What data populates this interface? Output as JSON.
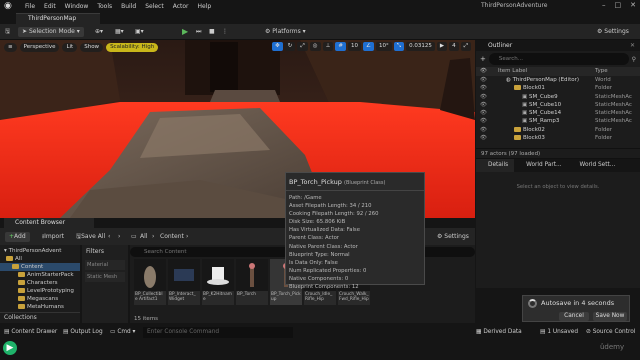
{
  "app": {
    "window_title": "ThirdPersonAdventure",
    "menu": [
      "File",
      "Edit",
      "Window",
      "Tools",
      "Build",
      "Select",
      "Actor",
      "Help"
    ],
    "level_tab": "ThirdPersonMap"
  },
  "toolbar": {
    "selection_mode": "Selection Mode",
    "platforms": "Platforms",
    "settings": "Settings"
  },
  "viewport": {
    "perspective": "Perspective",
    "lit": "Lit",
    "show": "Show",
    "scalability": "Scalability: High",
    "grid_snap": "10",
    "rot_snap": "10°",
    "scale_snap": "0.03125",
    "cam_speed": "4"
  },
  "tooltip": {
    "name": "BP_Torch_Pickup",
    "class": "(Blueprint Class)",
    "rows": [
      "Path: /Game",
      "Asset Filepath Length: 34 / 210",
      "Cooking Filepath Length: 92 / 260",
      "Disk Size: 65.806 KiB",
      "Has Virtualized Data: False",
      "Parent Class: Actor",
      "Native Parent Class: Actor",
      "Blueprint Type: Normal",
      "Is Data Only: False",
      "Num Replicated Properties: 0",
      "Native Components: 0",
      "Blueprint Components: 12"
    ]
  },
  "outliner": {
    "title": "Outliner",
    "search_placeholder": "Search...",
    "col_label": "Item Label",
    "col_type": "Type",
    "rows": [
      {
        "label": "ThirdPersonMap (Editor)",
        "type": "World",
        "indent": 0,
        "kind": "world"
      },
      {
        "label": "Block01",
        "type": "Folder",
        "indent": 1,
        "kind": "folder"
      },
      {
        "label": "SM_Cube9",
        "type": "StaticMeshAc",
        "indent": 2,
        "kind": "mesh"
      },
      {
        "label": "SM_Cube10",
        "type": "StaticMeshAc",
        "indent": 2,
        "kind": "mesh"
      },
      {
        "label": "SM_Cube14",
        "type": "StaticMeshAc",
        "indent": 2,
        "kind": "mesh"
      },
      {
        "label": "SM_Ramp3",
        "type": "StaticMeshAc",
        "indent": 2,
        "kind": "mesh"
      },
      {
        "label": "Block02",
        "type": "Folder",
        "indent": 1,
        "kind": "folder"
      },
      {
        "label": "Block03",
        "type": "Folder",
        "indent": 1,
        "kind": "folder"
      }
    ],
    "status": "97 actors (97 loaded)"
  },
  "details": {
    "tabs": [
      "Details",
      "World Part...",
      "World Sett..."
    ],
    "hint": "Select an object to view details."
  },
  "content_browser": {
    "tab": "Content Browser",
    "add": "Add",
    "import": "Import",
    "save_all": "Save All",
    "path": [
      "All",
      "Content"
    ],
    "settings": "Settings",
    "search_placeholder": "Search Content",
    "filters_title": "Filters",
    "filters": [
      "Material",
      "Static Mesh"
    ],
    "project": "ThirdPersonAdvent",
    "tree": [
      {
        "label": "All",
        "indent": 0
      },
      {
        "label": "Content",
        "indent": 1
      },
      {
        "label": "AnimStarterPack",
        "indent": 2
      },
      {
        "label": "Characters",
        "indent": 2
      },
      {
        "label": "LevelPrototyping",
        "indent": 2
      },
      {
        "label": "Megascans",
        "indent": 2
      },
      {
        "label": "MetaHumans",
        "indent": 2
      }
    ],
    "collections": "Collections",
    "assets": [
      {
        "name": "BP_Collectible Artifact1",
        "selected": false
      },
      {
        "name": "BP_Interact_Widget",
        "selected": false
      },
      {
        "name": "BP_K2Hitname",
        "selected": false
      },
      {
        "name": "BP_Torch",
        "selected": false
      },
      {
        "name": "BP_Torch_Pickup",
        "selected": true
      },
      {
        "name": "Crouch_Idle_Rifle_Hip",
        "selected": false
      },
      {
        "name": "Crouch_Walk_Fwd_Rifle_Hip",
        "selected": false
      }
    ],
    "item_count": "15 items"
  },
  "bottom": {
    "content_drawer": "Content Drawer",
    "output_log": "Output Log",
    "cmd": "Cmd",
    "console_placeholder": "Enter Console Command",
    "derived_data": "Derived Data",
    "unsaved": "1 Unsaved",
    "source_control": "Source Control"
  },
  "autosave": {
    "message": "Autosave in 4 seconds",
    "cancel": "Cancel",
    "save_now": "Save Now"
  },
  "watermark": "ûdemy"
}
